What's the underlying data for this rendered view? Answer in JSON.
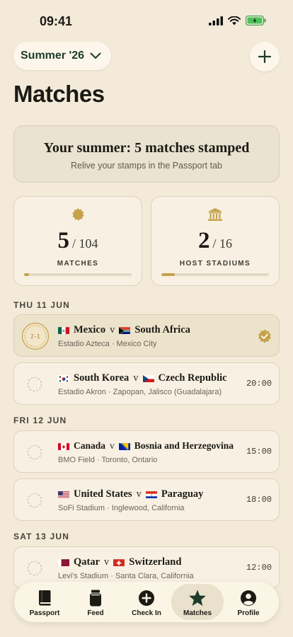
{
  "status_bar": {
    "time": "09:41"
  },
  "header": {
    "season_label": "Summer '26",
    "title": "Matches"
  },
  "banner": {
    "title": "Your summer: 5 matches stamped",
    "subtitle": "Relive your stamps in the Passport tab"
  },
  "stats": [
    {
      "value": "5",
      "total": "/ 104",
      "label": "MATCHES",
      "progress": 0.048,
      "icon": "seal-icon"
    },
    {
      "value": "2",
      "total": "/ 16",
      "label": "HOST STADIUMS",
      "progress": 0.125,
      "icon": "stadium-icon"
    }
  ],
  "days": [
    {
      "label": "THU 11 JUN",
      "matches": [
        {
          "home": "Mexico",
          "away": "South Africa",
          "venue": "Estadio Azteca · Mexico City",
          "time": "",
          "stamped": true,
          "stamp_text": "2–1"
        },
        {
          "home": "South Korea",
          "away": "Czech Republic",
          "venue": "Estadio Akron · Zapopan, Jalisco (Guadalajara)",
          "time": "20:00",
          "stamped": false
        }
      ]
    },
    {
      "label": "FRI 12 JUN",
      "matches": [
        {
          "home": "Canada",
          "away": "Bosnia and Herzegovina",
          "venue": "BMO Field · Toronto, Ontario",
          "time": "15:00",
          "stamped": false
        },
        {
          "home": "United States",
          "away": "Paraguay",
          "venue": "SoFi Stadium · Inglewood, California",
          "time": "18:00",
          "stamped": false
        }
      ]
    },
    {
      "label": "SAT 13 JUN",
      "matches": [
        {
          "home": "Qatar",
          "away": "Switzerland",
          "venue": "Levi's Stadium · Santa Clara, California",
          "time": "12:00",
          "stamped": false
        }
      ]
    }
  ],
  "versus": "v",
  "tabs": [
    {
      "label": "Passport",
      "icon": "book-icon",
      "active": false
    },
    {
      "label": "Feed",
      "icon": "jar-icon",
      "active": false
    },
    {
      "label": "Check In",
      "icon": "plus-circle-icon",
      "active": false
    },
    {
      "label": "Matches",
      "icon": "star-icon",
      "active": true
    },
    {
      "label": "Profile",
      "icon": "user-circle-icon",
      "active": false
    }
  ],
  "colors": {
    "background": "#f3ead9",
    "accent_gold": "#c6a24a",
    "brand_green": "#1d3b2a"
  }
}
